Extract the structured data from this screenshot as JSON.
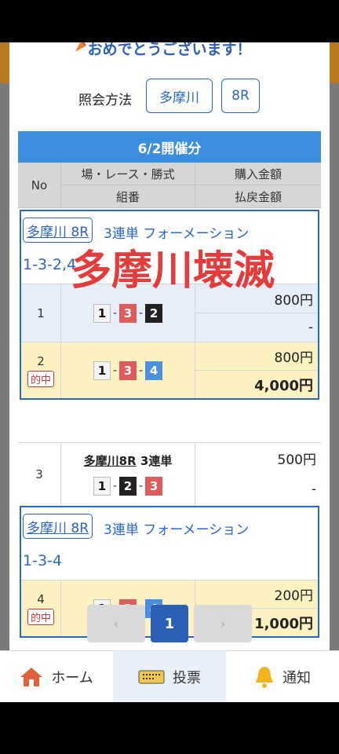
{
  "modal": {
    "congrats": "おめでとうございます！",
    "query_label": "照会方法",
    "query_venue": "多摩川",
    "query_race": "8R"
  },
  "table": {
    "date_header": "6/2開催分",
    "col_no": "No",
    "col_race": "場・レース・勝式",
    "col_combo": "組番",
    "col_purchase": "購入金額",
    "col_payout": "払戻金額"
  },
  "group1": {
    "venue": "多摩川 8R",
    "bet_type": "3連単 フォーメーション",
    "combo": "1-3-2,4",
    "rows": [
      {
        "no": "1",
        "nums": [
          "1",
          "3",
          "2"
        ],
        "purchase": "800円",
        "payout": "-"
      },
      {
        "no": "2",
        "hit": "的中",
        "nums": [
          "1",
          "3",
          "4"
        ],
        "purchase": "800円",
        "payout": "4,000円"
      }
    ]
  },
  "row3": {
    "no": "3",
    "venue": "多摩川8R",
    "bet_type": "3連単",
    "nums": [
      "1",
      "2",
      "3"
    ],
    "purchase": "500円",
    "payout": "-"
  },
  "group2": {
    "venue": "多摩川 8R",
    "bet_type": "3連単 フォーメーション",
    "combo": "1-3-4",
    "rows": [
      {
        "no": "4",
        "hit": "的中",
        "nums": [
          "1",
          "3",
          "4"
        ],
        "purchase": "200円",
        "payout": "1,000円"
      }
    ]
  },
  "overlay": "多摩川壊滅",
  "pager": {
    "prev": "‹",
    "current": "1",
    "next": "›"
  },
  "tabbar": {
    "home": "ホーム",
    "vote": "投票",
    "notify": "通知"
  },
  "colors": {
    "accent": "#2a66c8",
    "header_blue": "#3c8ee0",
    "hit_red": "#c23a3a",
    "overlay_red": "#e63b3b"
  }
}
